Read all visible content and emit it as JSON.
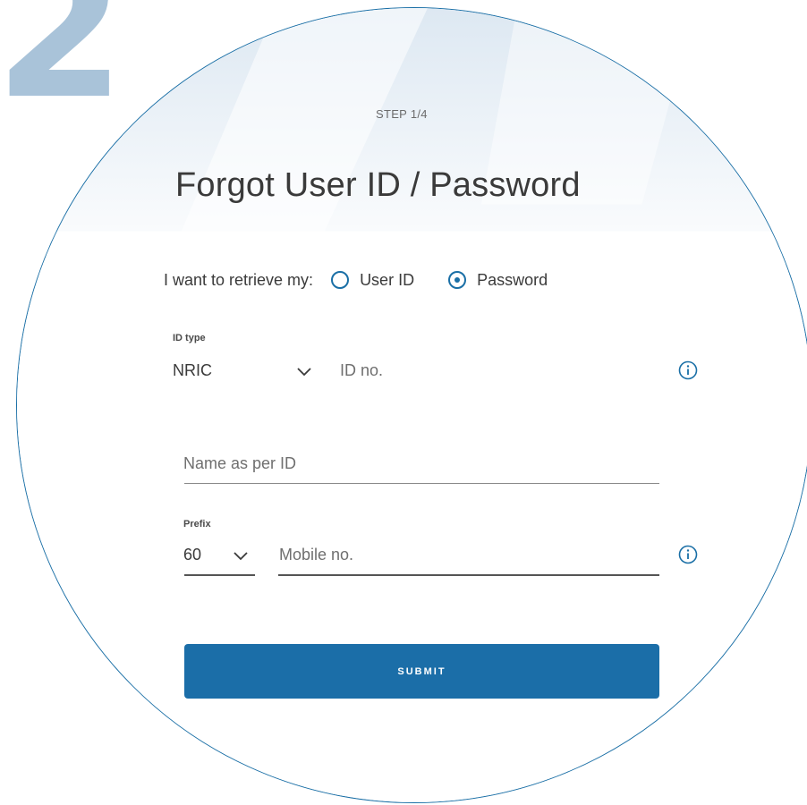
{
  "step_number": "2",
  "step_label": "STEP 1/4",
  "title": "Forgot User ID / Password",
  "retrieve": {
    "prompt": "I want to retrieve my:",
    "options": [
      {
        "label": "User ID",
        "selected": false
      },
      {
        "label": "Password",
        "selected": true
      }
    ]
  },
  "id_section": {
    "label": "ID type",
    "value": "NRIC",
    "id_no_placeholder": "ID no."
  },
  "name_field": {
    "placeholder": "Name as per ID"
  },
  "mobile_section": {
    "prefix_label": "Prefix",
    "prefix_value": "60",
    "mobile_placeholder": "Mobile no."
  },
  "submit_label": "SUBMIT",
  "colors": {
    "accent": "#1b6ea8",
    "step_number": "#a9c3d9",
    "circle_border": "#1a6fa6"
  },
  "icons": {
    "dropdown": "chevron-down-icon",
    "info": "info-icon"
  }
}
